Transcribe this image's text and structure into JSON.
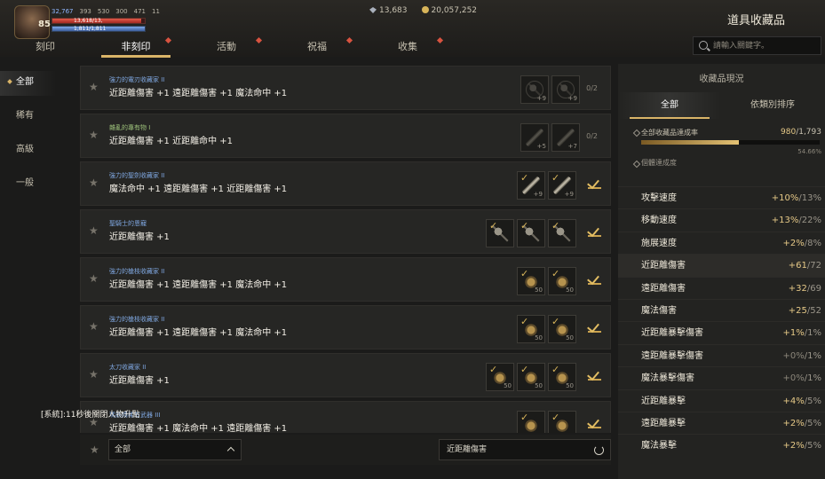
{
  "hud": {
    "level": "85",
    "stats": [
      "32,767",
      "393",
      "530",
      "300",
      "471",
      "11"
    ],
    "hp_text": "13,618/13,",
    "mp_text": "1,811/1,811",
    "currency_gem": "13,683",
    "currency_gold": "20,057,252"
  },
  "page_title": "道具收藏品",
  "tabs": [
    {
      "label": "刻印",
      "has_dot": false
    },
    {
      "label": "非刻印",
      "has_dot": true,
      "active": true
    },
    {
      "label": "活動",
      "has_dot": true
    },
    {
      "label": "祝福",
      "has_dot": true
    },
    {
      "label": "收集",
      "has_dot": true
    }
  ],
  "search": {
    "placeholder": "請輸入關鍵字。"
  },
  "sidebar": [
    "全部",
    "稀有",
    "高級",
    "一般"
  ],
  "rows": [
    {
      "name": "強力的電刃收藏家 II",
      "name_color": "#7fa7e0",
      "effect": "近距離傷害 +1 遠距離傷害 +1 魔法命中 +1",
      "slots": [
        {
          "type": "circle",
          "count": "+9",
          "ghost": true
        },
        {
          "type": "circle",
          "count": "+9",
          "ghost": true
        }
      ],
      "progress": "0/2"
    },
    {
      "name": "雜亂的專有物 I",
      "name_color": "#9cc07a",
      "effect": "近距離傷害 +1 近距離命中 +1",
      "slots": [
        {
          "type": "blade",
          "count": "+5",
          "ghost": true
        },
        {
          "type": "blade",
          "count": "+7",
          "ghost": true
        }
      ],
      "progress": "0/2"
    },
    {
      "name": "強力的聖劍收藏家 II",
      "name_color": "#7fa7e0",
      "effect": "魔法命中 +1 遠距離傷害 +1 近距離傷害 +1",
      "slots": [
        {
          "type": "blade",
          "count": "+9",
          "tick": true
        },
        {
          "type": "blade",
          "count": "+9",
          "tick": true
        }
      ],
      "done": true
    },
    {
      "name": "聖騎士的恩寵",
      "name_color": "#7fa7e0",
      "effect": "近距離傷害 +1",
      "slots": [
        {
          "type": "axe",
          "tick": true
        },
        {
          "type": "axe",
          "tick": true
        },
        {
          "type": "axe",
          "tick": true
        }
      ],
      "done": true
    },
    {
      "name": "強力的槍枝收藏家 II",
      "name_color": "#7fa7e0",
      "effect": "近距離傷害 +1 遠距離傷害 +1 魔法命中 +1",
      "slots": [
        {
          "type": "gauntlet",
          "count": "50",
          "tick": true
        },
        {
          "type": "gauntlet",
          "count": "50",
          "tick": true
        }
      ],
      "done": true
    },
    {
      "name": "強力的槍枝收藏家 II",
      "name_color": "#7fa7e0",
      "effect": "近距離傷害 +1 遠距離傷害 +1 魔法命中 +1",
      "slots": [
        {
          "type": "gauntlet",
          "count": "50",
          "tick": true
        },
        {
          "type": "gauntlet",
          "count": "50",
          "tick": true
        }
      ],
      "done": true
    },
    {
      "name": "太刀收藏家 II",
      "name_color": "#7fa7e0",
      "effect": "近距離傷害 +1",
      "slots": [
        {
          "type": "gauntlet",
          "count": "50",
          "tick": true
        },
        {
          "type": "gauntlet",
          "count": "50",
          "tick": true
        },
        {
          "type": "gauntlet",
          "count": "50",
          "tick": true
        }
      ],
      "done": true
    },
    {
      "name": "瑪妖精稀有武器 III",
      "name_color": "#7fa7e0",
      "effect": "近距離傷害 +1 魔法命中 +1 遠距離傷害 +1",
      "slots": [
        {
          "type": "gauntlet",
          "count": "",
          "tick": true
        },
        {
          "type": "gauntlet",
          "count": "",
          "tick": true
        }
      ],
      "done": true
    }
  ],
  "system_message": "[系統]:11秒後關閉人物升點",
  "bottom": {
    "filter_value": "全部",
    "stat_value": "近距離傷害"
  },
  "panel": {
    "title": "收藏品現況",
    "tabs": [
      "全部",
      "依類別排序"
    ],
    "overall_label": "全部收藏品達成率",
    "overall_value": "980",
    "overall_max": "/1,793",
    "overall_fraction": 0.5466,
    "overall_percent": "54.66%",
    "section_title": "個體達成度",
    "stats": [
      {
        "name": "攻擊速度",
        "value": "+10%",
        "max": "/13%"
      },
      {
        "name": "移動速度",
        "value": "+13%",
        "max": "/22%"
      },
      {
        "name": "施展速度",
        "value": "+2%",
        "max": "/8%"
      },
      {
        "name": "近距離傷害",
        "value": "+61",
        "max": "/72",
        "highlight": true
      },
      {
        "name": "遠距離傷害",
        "value": "+32",
        "max": "/69"
      },
      {
        "name": "魔法傷害",
        "value": "+25",
        "max": "/52"
      },
      {
        "name": "近距離暴擊傷害",
        "value": "+1%",
        "max": "/1%"
      },
      {
        "name": "遠距離暴擊傷害",
        "value": "+0%",
        "max": "/1%",
        "zero": true
      },
      {
        "name": "魔法暴擊傷害",
        "value": "+0%",
        "max": "/1%",
        "zero": true
      },
      {
        "name": "近距離暴擊",
        "value": "+4%",
        "max": "/5%"
      },
      {
        "name": "遠距離暴擊",
        "value": "+2%",
        "max": "/5%"
      },
      {
        "name": "魔法暴擊",
        "value": "+2%",
        "max": "/5%"
      }
    ]
  }
}
